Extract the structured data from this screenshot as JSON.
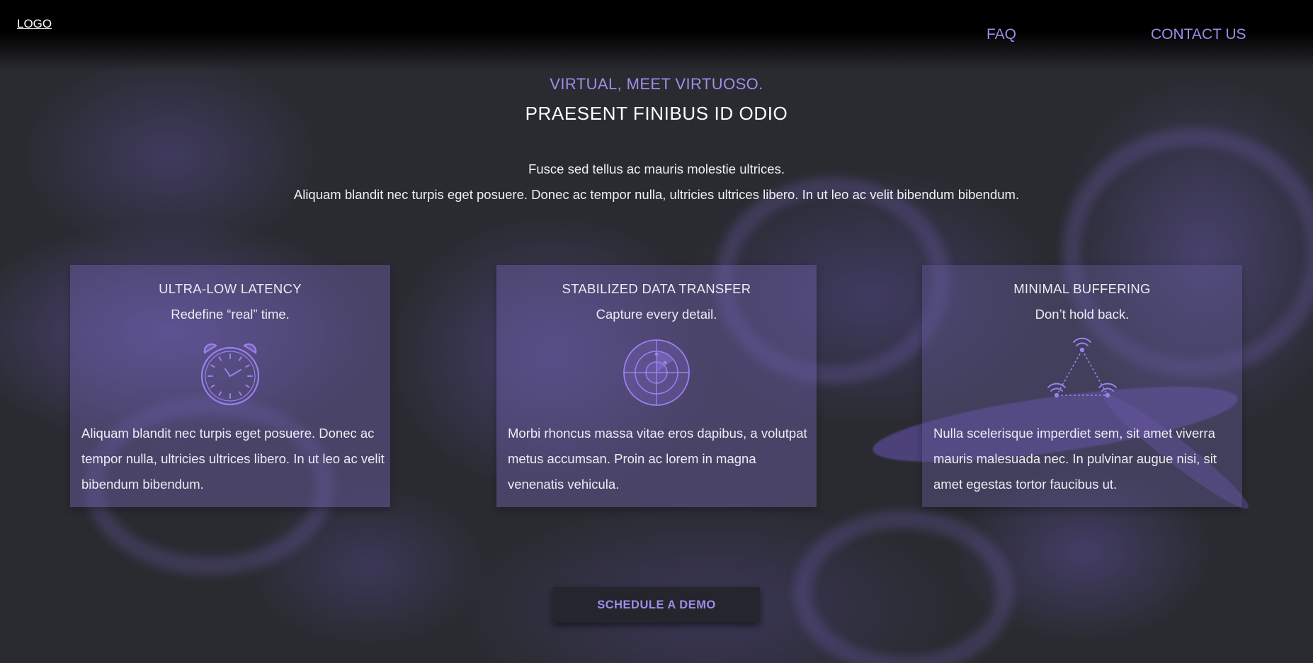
{
  "nav": {
    "logo": "LOGO",
    "links": [
      "FAQ",
      "CONTACT US"
    ]
  },
  "hero": {
    "tagline": "VIRTUAL, MEET VIRTUOSO.",
    "headline": "PRAESENT FINIBUS ID ODIO",
    "lead_line1": "Fusce sed tellus ac mauris molestie ultrices.",
    "lead_line2": "Aliquam blandit nec turpis eget posuere. Donec ac tempor nulla, ultricies ultrices libero. In ut leo ac velit bibendum bibendum."
  },
  "features": [
    {
      "title": "ULTRA-LOW LATENCY",
      "subtitle": "Redefine “real” time.",
      "icon": "stopwatch-icon",
      "body": "Aliquam blandit nec turpis eget posuere. Donec ac tempor nulla, ultricies ultrices libero. In ut leo ac velit bibendum bibendum."
    },
    {
      "title": "STABILIZED DATA TRANSFER",
      "subtitle": "Capture every detail.",
      "icon": "radar-icon",
      "body": "Morbi rhoncus massa vitae eros dapibus, a volutpat metus accumsan. Proin ac lorem in magna venenatis vehicula."
    },
    {
      "title": "MINIMAL BUFFERING",
      "subtitle": "Don’t hold back.",
      "icon": "wifi-network-icon",
      "body": "Nulla scelerisque imperdiet sem, sit amet viverra mauris malesuada nec. In pulvinar augue nisi, sit amet egestas tortor faucibus ut."
    }
  ],
  "cta": {
    "label": "SCHEDULE A DEMO"
  },
  "colors": {
    "accent": "#9e8ee8",
    "background": "#2a2b31",
    "card": "#6e62aa",
    "button_bg": "#24252d"
  }
}
